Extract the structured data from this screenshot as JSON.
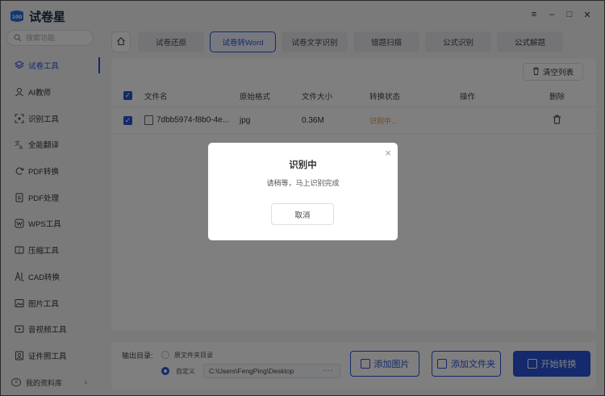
{
  "app": {
    "title": "试卷星"
  },
  "search": {
    "placeholder": "搜索功能"
  },
  "sidebar": {
    "items": [
      {
        "label": "试卷工具",
        "icon": "layers-icon",
        "active": true
      },
      {
        "label": "AI教师",
        "icon": "ai-teacher-icon"
      },
      {
        "label": "识别工具",
        "icon": "scan-icon"
      },
      {
        "label": "全能翻译",
        "icon": "translate-icon"
      },
      {
        "label": "PDF转换",
        "icon": "pdf-convert-icon"
      },
      {
        "label": "PDF处理",
        "icon": "pdf-process-icon"
      },
      {
        "label": "WPS工具",
        "icon": "wps-icon"
      },
      {
        "label": "压缩工具",
        "icon": "compress-icon"
      },
      {
        "label": "CAD转换",
        "icon": "cad-icon"
      },
      {
        "label": "图片工具",
        "icon": "image-icon"
      },
      {
        "label": "音视频工具",
        "icon": "media-icon"
      },
      {
        "label": "证件照工具",
        "icon": "id-photo-icon"
      }
    ],
    "footer": {
      "label": "我的资料库"
    }
  },
  "window": {
    "menu": "≡",
    "minimize": "–",
    "maximize": "□",
    "close": "✕"
  },
  "tabs": [
    {
      "label": "试卷还原"
    },
    {
      "label": "试卷转Word",
      "active": true
    },
    {
      "label": "试卷文字识别"
    },
    {
      "label": "错题扫描"
    },
    {
      "label": "公式识别"
    },
    {
      "label": "公式解题"
    }
  ],
  "toolbar": {
    "clear_label": "清空列表"
  },
  "table": {
    "headers": [
      "文件名",
      "原始格式",
      "文件大小",
      "转换状态",
      "操作",
      "删除"
    ],
    "rows": [
      {
        "name": "7dbb5974-f8b0-4e...",
        "format": "jpg",
        "size": "0.36M",
        "status": "识别中..."
      }
    ]
  },
  "output": {
    "label": "输出目录:",
    "option_source": "原文件夹目录",
    "option_custom": "自定义",
    "path": "C:\\Users\\FengPing\\Desktop",
    "browse": "···"
  },
  "buttons": {
    "add_image": "添加图片",
    "add_folder": "添加文件夹",
    "start": "开始转换"
  },
  "modal": {
    "title": "识别中",
    "message": "请稍等，马上识别完成",
    "cancel": "取消",
    "close": "×"
  },
  "colors": {
    "accent": "#2955d8",
    "status": "#e8943a"
  }
}
